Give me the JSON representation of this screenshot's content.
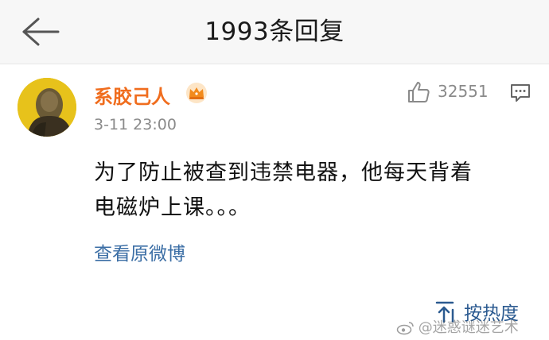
{
  "header": {
    "title": "1993条回复"
  },
  "comment": {
    "username": "系胶己人",
    "timestamp": "3-11 23:00",
    "likes": "32551",
    "content_line1": "为了防止被查到违禁电器，他每天背着",
    "content_line2": "电磁炉上课。。。",
    "view_original_label": "查看原微博"
  },
  "sort": {
    "label": "按热度"
  },
  "watermark": {
    "handle": "@迷惑谜迷艺术"
  },
  "colors": {
    "username": "#f06d1e",
    "link": "#3b6ea5",
    "avatar_bg": "#e7c21b",
    "header_bg": "#f7f7f7"
  },
  "icons": [
    "back-arrow-icon",
    "crown-icon",
    "thumbs-up-icon",
    "reply-comment-icon",
    "sort-icon",
    "weibo-icon"
  ]
}
